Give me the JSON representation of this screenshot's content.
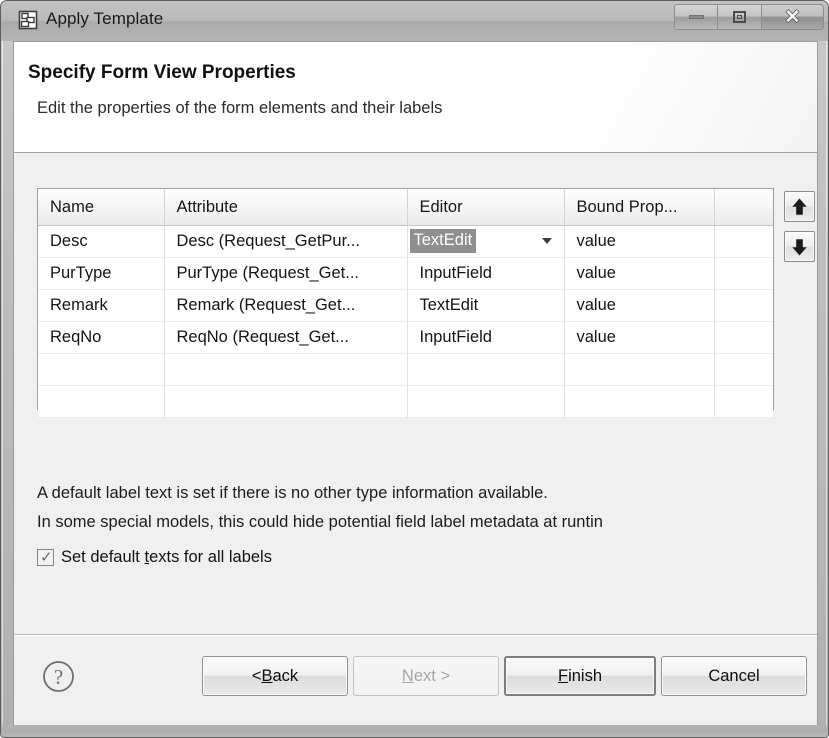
{
  "window": {
    "title": "Apply Template",
    "icon": "template-icon",
    "controls": {
      "minimize": "minimize-icon",
      "maximize": "maximize-icon",
      "close": "close-icon"
    }
  },
  "header": {
    "title": "Specify Form View Properties",
    "subtitle": "Edit the properties of the form elements and their labels"
  },
  "table": {
    "columns": [
      "Name",
      "Attribute",
      "Editor",
      "Bound Prop...",
      ""
    ],
    "rows": [
      {
        "name": "Desc",
        "attribute": "Desc (Request_GetPur...",
        "editor": "TextEdit",
        "editor_editing": true,
        "bound_property": "value",
        "extra": ""
      },
      {
        "name": "PurType",
        "attribute": "PurType (Request_Get...",
        "editor": "InputField",
        "editor_editing": false,
        "bound_property": "value",
        "extra": ""
      },
      {
        "name": "Remark",
        "attribute": "Remark (Request_Get...",
        "editor": "TextEdit",
        "editor_editing": false,
        "bound_property": "value",
        "extra": ""
      },
      {
        "name": "ReqNo",
        "attribute": "ReqNo (Request_Get...",
        "editor": "InputField",
        "editor_editing": false,
        "bound_property": "value",
        "extra": ""
      }
    ],
    "empty_rows": 2
  },
  "side_buttons": {
    "move_up": "arrow-up-icon",
    "move_down": "arrow-down-icon"
  },
  "notes": {
    "line1": "A default label text is set if there is no other type information available.",
    "line2": "In some special models, this could hide potential field label metadata at runtin"
  },
  "checkbox": {
    "checked": true,
    "label_before": "Set default ",
    "label_mnemonic": "t",
    "label_after": "exts for all labels"
  },
  "footer": {
    "help": "help-icon",
    "buttons": [
      {
        "id": "back",
        "prefix": "< ",
        "mnemonic": "B",
        "suffix": "ack",
        "state": "enabled"
      },
      {
        "id": "next",
        "prefix": "",
        "mnemonic": "N",
        "suffix": "ext >",
        "state": "disabled"
      },
      {
        "id": "finish",
        "prefix": "",
        "mnemonic": "F",
        "suffix": "inish",
        "state": "default"
      },
      {
        "id": "cancel",
        "prefix": "",
        "mnemonic": "",
        "suffix": "Cancel",
        "state": "enabled"
      }
    ]
  },
  "colors": {
    "window_bg": "#f0f0f0",
    "titlebar": "#b8b8b8",
    "selection": "#8f8f8f",
    "grid_line": "#e2e2e2"
  }
}
